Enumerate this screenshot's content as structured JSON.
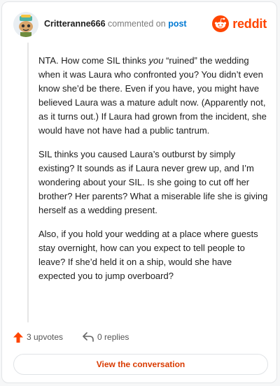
{
  "header": {
    "username": "Critteranne666",
    "verb": "commented on",
    "target": "post",
    "brand": "reddit"
  },
  "comment": {
    "p1_a": "NTA. How come SIL thinks ",
    "p1_em": "you",
    "p1_b": " “ruined” the wedding when it was Laura who confronted you? You didn’t even know she’d be there. Even if you have, you might have believed Laura was a mature adult now. (Apparently not, as it turns out.) If Laura had grown from the incident, she would have not have had a public tantrum.",
    "p2": "SIL thinks you caused Laura’s outburst by simply existing? It sounds as if Laura never grew up, and I’m wondering about your SIL. Is she going to cut off her brother? Her parents? What a miserable life she is giving herself as a wedding present.",
    "p3": "Also, if you hold your wedding at a place where guests stay overnight, how can you expect to tell people to leave? If she’d held it on a ship, would she have expected you to jump overboard?"
  },
  "actions": {
    "upvotes": "3 upvotes",
    "replies": "0 replies"
  },
  "cta": "View the conversation",
  "colors": {
    "brand": "#ff4500",
    "link": "#0079d3",
    "cta": "#d93a00"
  },
  "icons": [
    "avatar-snoo",
    "reddit-logo-icon",
    "upvote-arrow-icon",
    "reply-arrow-icon"
  ]
}
